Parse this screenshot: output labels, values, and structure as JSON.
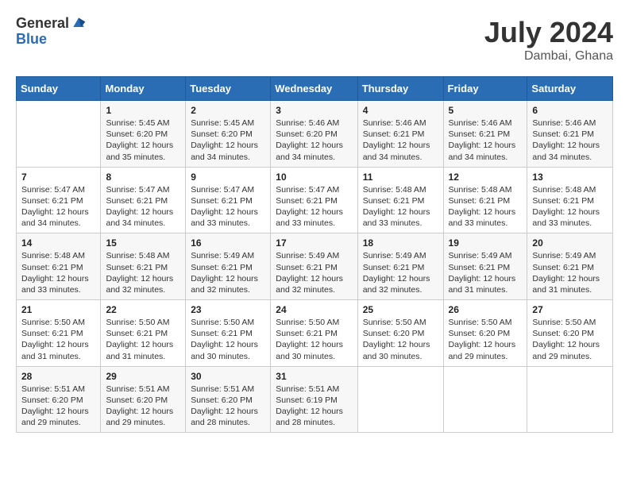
{
  "logo": {
    "general": "General",
    "blue": "Blue"
  },
  "title": {
    "month": "July 2024",
    "location": "Dambai, Ghana"
  },
  "days_of_week": [
    "Sunday",
    "Monday",
    "Tuesday",
    "Wednesday",
    "Thursday",
    "Friday",
    "Saturday"
  ],
  "weeks": [
    [
      {
        "day": "",
        "info": ""
      },
      {
        "day": "1",
        "info": "Sunrise: 5:45 AM\nSunset: 6:20 PM\nDaylight: 12 hours\nand 35 minutes."
      },
      {
        "day": "2",
        "info": "Sunrise: 5:45 AM\nSunset: 6:20 PM\nDaylight: 12 hours\nand 34 minutes."
      },
      {
        "day": "3",
        "info": "Sunrise: 5:46 AM\nSunset: 6:20 PM\nDaylight: 12 hours\nand 34 minutes."
      },
      {
        "day": "4",
        "info": "Sunrise: 5:46 AM\nSunset: 6:21 PM\nDaylight: 12 hours\nand 34 minutes."
      },
      {
        "day": "5",
        "info": "Sunrise: 5:46 AM\nSunset: 6:21 PM\nDaylight: 12 hours\nand 34 minutes."
      },
      {
        "day": "6",
        "info": "Sunrise: 5:46 AM\nSunset: 6:21 PM\nDaylight: 12 hours\nand 34 minutes."
      }
    ],
    [
      {
        "day": "7",
        "info": "Sunrise: 5:47 AM\nSunset: 6:21 PM\nDaylight: 12 hours\nand 34 minutes."
      },
      {
        "day": "8",
        "info": "Sunrise: 5:47 AM\nSunset: 6:21 PM\nDaylight: 12 hours\nand 34 minutes."
      },
      {
        "day": "9",
        "info": "Sunrise: 5:47 AM\nSunset: 6:21 PM\nDaylight: 12 hours\nand 33 minutes."
      },
      {
        "day": "10",
        "info": "Sunrise: 5:47 AM\nSunset: 6:21 PM\nDaylight: 12 hours\nand 33 minutes."
      },
      {
        "day": "11",
        "info": "Sunrise: 5:48 AM\nSunset: 6:21 PM\nDaylight: 12 hours\nand 33 minutes."
      },
      {
        "day": "12",
        "info": "Sunrise: 5:48 AM\nSunset: 6:21 PM\nDaylight: 12 hours\nand 33 minutes."
      },
      {
        "day": "13",
        "info": "Sunrise: 5:48 AM\nSunset: 6:21 PM\nDaylight: 12 hours\nand 33 minutes."
      }
    ],
    [
      {
        "day": "14",
        "info": "Sunrise: 5:48 AM\nSunset: 6:21 PM\nDaylight: 12 hours\nand 33 minutes."
      },
      {
        "day": "15",
        "info": "Sunrise: 5:48 AM\nSunset: 6:21 PM\nDaylight: 12 hours\nand 32 minutes."
      },
      {
        "day": "16",
        "info": "Sunrise: 5:49 AM\nSunset: 6:21 PM\nDaylight: 12 hours\nand 32 minutes."
      },
      {
        "day": "17",
        "info": "Sunrise: 5:49 AM\nSunset: 6:21 PM\nDaylight: 12 hours\nand 32 minutes."
      },
      {
        "day": "18",
        "info": "Sunrise: 5:49 AM\nSunset: 6:21 PM\nDaylight: 12 hours\nand 32 minutes."
      },
      {
        "day": "19",
        "info": "Sunrise: 5:49 AM\nSunset: 6:21 PM\nDaylight: 12 hours\nand 31 minutes."
      },
      {
        "day": "20",
        "info": "Sunrise: 5:49 AM\nSunset: 6:21 PM\nDaylight: 12 hours\nand 31 minutes."
      }
    ],
    [
      {
        "day": "21",
        "info": "Sunrise: 5:50 AM\nSunset: 6:21 PM\nDaylight: 12 hours\nand 31 minutes."
      },
      {
        "day": "22",
        "info": "Sunrise: 5:50 AM\nSunset: 6:21 PM\nDaylight: 12 hours\nand 31 minutes."
      },
      {
        "day": "23",
        "info": "Sunrise: 5:50 AM\nSunset: 6:21 PM\nDaylight: 12 hours\nand 30 minutes."
      },
      {
        "day": "24",
        "info": "Sunrise: 5:50 AM\nSunset: 6:21 PM\nDaylight: 12 hours\nand 30 minutes."
      },
      {
        "day": "25",
        "info": "Sunrise: 5:50 AM\nSunset: 6:20 PM\nDaylight: 12 hours\nand 30 minutes."
      },
      {
        "day": "26",
        "info": "Sunrise: 5:50 AM\nSunset: 6:20 PM\nDaylight: 12 hours\nand 29 minutes."
      },
      {
        "day": "27",
        "info": "Sunrise: 5:50 AM\nSunset: 6:20 PM\nDaylight: 12 hours\nand 29 minutes."
      }
    ],
    [
      {
        "day": "28",
        "info": "Sunrise: 5:51 AM\nSunset: 6:20 PM\nDaylight: 12 hours\nand 29 minutes."
      },
      {
        "day": "29",
        "info": "Sunrise: 5:51 AM\nSunset: 6:20 PM\nDaylight: 12 hours\nand 29 minutes."
      },
      {
        "day": "30",
        "info": "Sunrise: 5:51 AM\nSunset: 6:20 PM\nDaylight: 12 hours\nand 28 minutes."
      },
      {
        "day": "31",
        "info": "Sunrise: 5:51 AM\nSunset: 6:19 PM\nDaylight: 12 hours\nand 28 minutes."
      },
      {
        "day": "",
        "info": ""
      },
      {
        "day": "",
        "info": ""
      },
      {
        "day": "",
        "info": ""
      }
    ]
  ]
}
